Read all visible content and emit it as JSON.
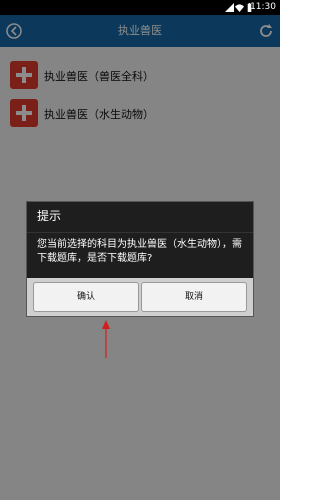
{
  "statusbar": {
    "time": "11:30",
    "icons": [
      "signal-icon",
      "wifi-icon",
      "battery-icon"
    ]
  },
  "header": {
    "title": "执业兽医",
    "back_icon": "back-icon",
    "refresh_icon": "refresh-icon",
    "color": "#1668a7"
  },
  "list": {
    "items": [
      {
        "label": "执业兽医（兽医全科）"
      },
      {
        "label": "执业兽医（水生动物）"
      }
    ]
  },
  "dialog": {
    "title": "提示",
    "message": "您当前选择的科目为执业兽医（水生动物），需下载题库，是否下载题库?",
    "confirm_label": "确认",
    "cancel_label": "取消"
  }
}
